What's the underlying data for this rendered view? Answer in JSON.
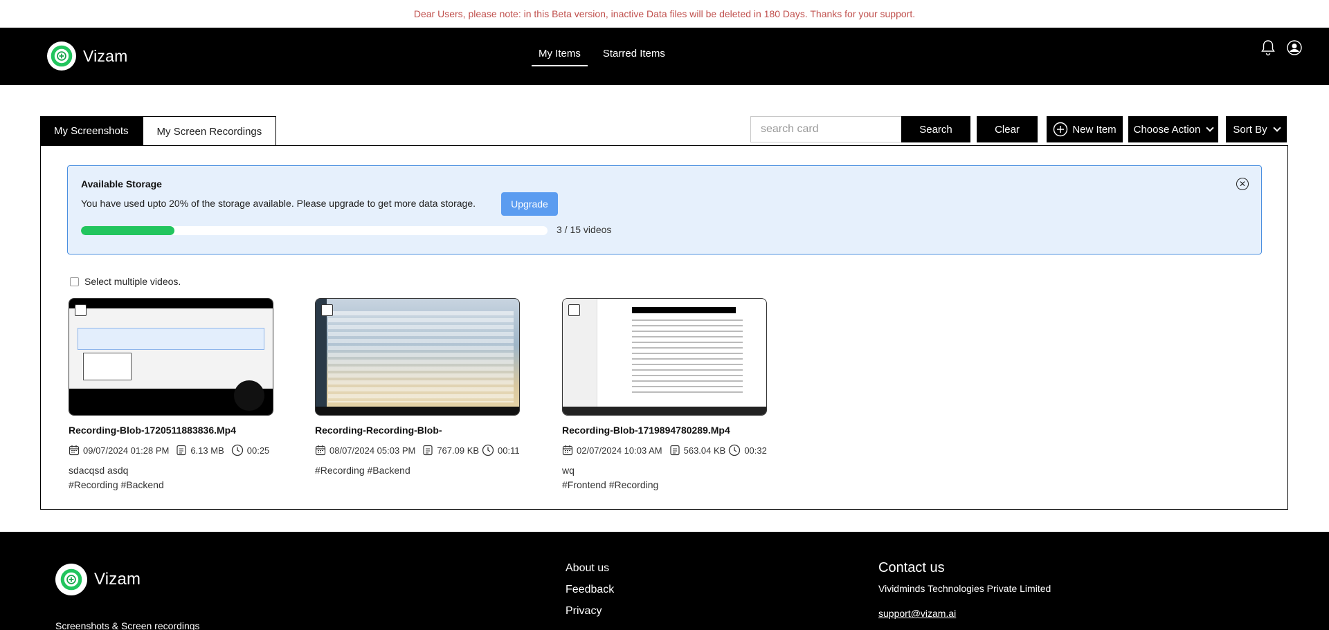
{
  "banner": {
    "text": "Dear Users, please note: in this Beta version, inactive Data files will be deleted in 180 Days. Thanks for your support."
  },
  "header": {
    "brand": "Vizam",
    "nav": [
      {
        "label": "My Items",
        "active": true
      },
      {
        "label": "Starred Items",
        "active": false
      }
    ],
    "icons": [
      "bell-icon",
      "avatar"
    ]
  },
  "tabs": [
    {
      "label": "My Screenshots",
      "active": false
    },
    {
      "label": "My Screen Recordings",
      "active": true
    }
  ],
  "toolbar": {
    "search_placeholder": "search card",
    "search_value": "",
    "search_label": "Search",
    "clear_label": "Clear",
    "new_label": "New Item",
    "action_label": "Choose Action",
    "sort_label": "Sort By"
  },
  "storage": {
    "title": "Available Storage",
    "message": "You have used upto 20% of the storage available. Please upgrade to get more data storage.",
    "upgrade_label": "Upgrade",
    "used_percent": 20,
    "count_text": "3 / 15 videos",
    "close_glyph": "✕"
  },
  "select_multiple_label": "Select multiple videos.",
  "cards": [
    {
      "title": "Recording-Blob-1720511883836.Mp4",
      "date": "09/07/2024 01:28 PM",
      "size": "6.13 MB",
      "duration": "00:25",
      "description": "sdacqsd asdq",
      "tags": "#Recording #Backend"
    },
    {
      "title": "Recording-Recording-Blob-",
      "date": "08/07/2024 05:03 PM",
      "size": "767.09 KB",
      "duration": "00:11",
      "description": "",
      "tags": "#Recording #Backend"
    },
    {
      "title": "Recording-Blob-1719894780289.Mp4",
      "date": "02/07/2024 10:03 AM",
      "size": "563.04 KB",
      "duration": "00:32",
      "description": "wq",
      "tags": "#Frontend #Recording"
    }
  ],
  "footer": {
    "brand": "Vizam",
    "tagline": "Screenshots & Screen recordings",
    "links": [
      "About us",
      "Feedback",
      "Privacy"
    ],
    "contact_title": "Contact us",
    "company": "Vividminds Technologies Private Limited",
    "email": "support@vizam.ai"
  },
  "colors": {
    "accent_green": "#22c55e",
    "upgrade_blue": "#5b9cf0",
    "banner_red": "#c0504d",
    "header_bg": "#000000"
  }
}
